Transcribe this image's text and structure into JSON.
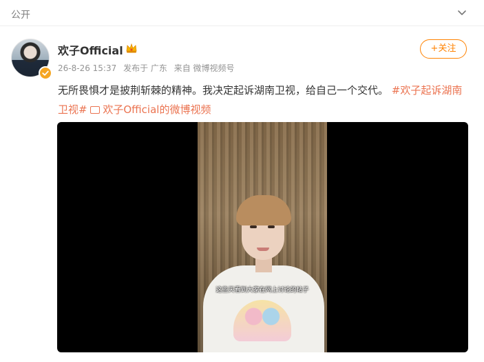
{
  "header": {
    "visibility": "公开",
    "collapse_icon": "chevron-down-icon"
  },
  "author": {
    "name": "欢子Official",
    "badge_icon": "crown-icon",
    "verified_icon": "verified-badge-icon"
  },
  "meta": {
    "time": "26-8-26 15:37",
    "location": "发布于 广东",
    "source": "来自 微博视频号"
  },
  "follow": {
    "label": "+关注"
  },
  "post": {
    "text": "无所畏惧才是披荆斩棘的精神。我决定起诉湖南卫视，给自己一个交代。",
    "topic": "#欢子起诉湖南卫视#",
    "video_link": "欢子Official的微博视频"
  },
  "video": {
    "subtitle": "这些天看到大家在网上讨论的帖子"
  },
  "colors": {
    "accent": "#ff8200",
    "link": "#eb7350",
    "text": "#333333",
    "muted": "#939393"
  }
}
